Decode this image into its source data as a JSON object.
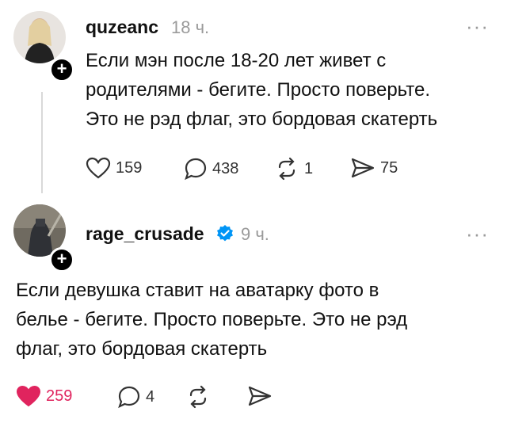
{
  "post1": {
    "username": "quzeanc",
    "time": "18 ч.",
    "more": "···",
    "lines": [
      "Если мэн после 18-20 лет живет с",
      "родителями -  бегите. Просто поверьте.",
      "Это не рэд флаг, это бордовая скатерть"
    ],
    "likes": "159",
    "comments": "438",
    "reposts": "1",
    "shares": "75"
  },
  "post2": {
    "username": "rage_crusade",
    "time": "9 ч.",
    "more": "···",
    "lines": [
      "Если девушка ставит на аватарку фото в",
      "белье -  бегите. Просто поверьте. Это не рэд",
      "флаг, это бордовая скатерть"
    ],
    "likes": "259",
    "comments": "4"
  },
  "icons": {
    "heart": "heart-icon",
    "comment": "comment-icon",
    "repost": "repost-icon",
    "share": "share-icon",
    "verified": "verified-badge-icon",
    "follow": "plus-icon"
  },
  "colors": {
    "liked_heart": "#e0245e",
    "muted": "#9a9a9a",
    "verified": "#0095f6"
  }
}
